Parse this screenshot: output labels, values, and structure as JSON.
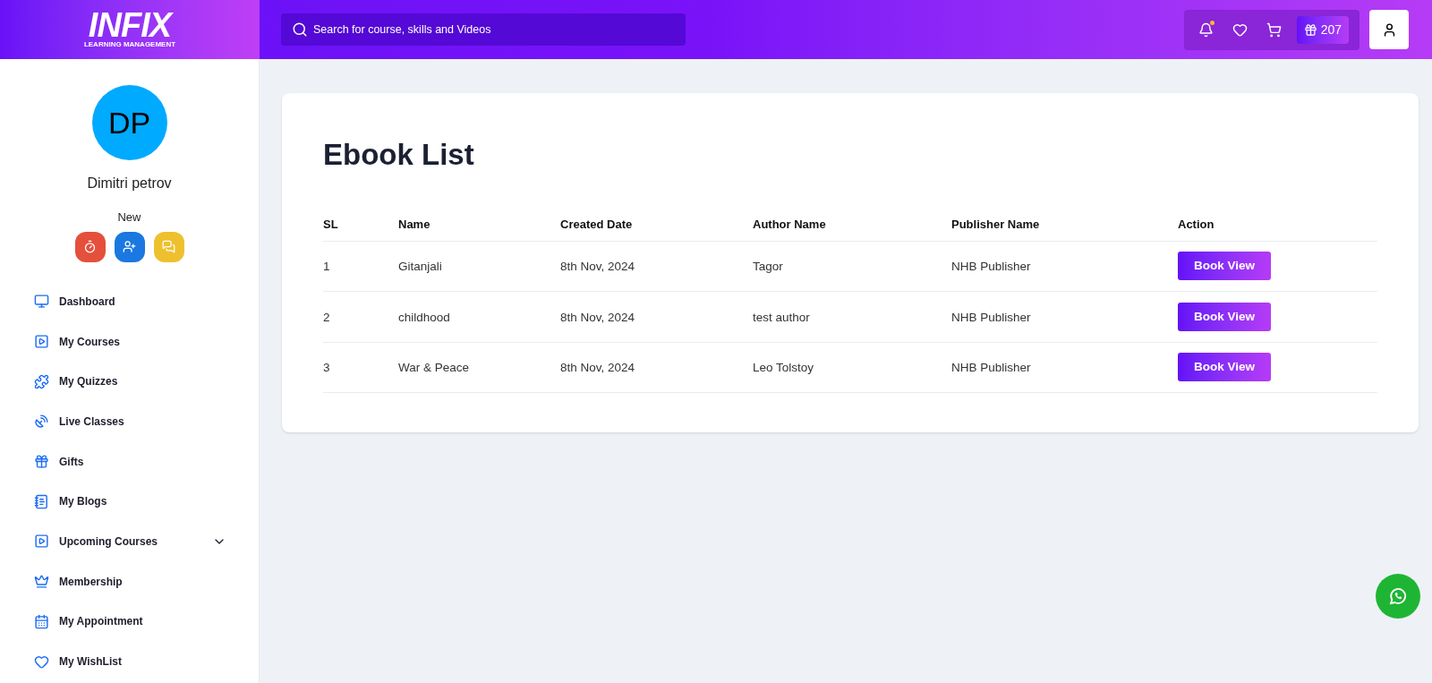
{
  "header": {
    "logo": {
      "wordmark": "INFIX",
      "tagline": "LEARNING MANAGEMENT"
    },
    "search": {
      "placeholder": "Search for course, skills and Videos"
    },
    "notifications": {
      "unread": true
    },
    "gift_points": "207"
  },
  "profile": {
    "initials": "DP",
    "name": "Dimitri petrov",
    "badge_level": "New"
  },
  "sidebar": {
    "items": [
      {
        "label": "Dashboard",
        "kind": "link"
      },
      {
        "label": "My Courses",
        "kind": "link"
      },
      {
        "label": "My Quizzes",
        "kind": "link"
      },
      {
        "label": "Live Classes",
        "kind": "link"
      },
      {
        "label": "Gifts",
        "kind": "link"
      },
      {
        "label": "My Blogs",
        "kind": "link"
      },
      {
        "label": "Upcoming Courses",
        "kind": "group",
        "expanded": false
      },
      {
        "label": "Membership",
        "kind": "link"
      },
      {
        "label": "My Appointment",
        "kind": "link"
      },
      {
        "label": "My WishList",
        "kind": "link"
      }
    ]
  },
  "page": {
    "title": "Ebook List",
    "table": {
      "columns": [
        "SL",
        "Name",
        "Created Date",
        "Author Name",
        "Publisher Name",
        "Action"
      ],
      "rows": [
        {
          "sl": "1",
          "name": "Gitanjali",
          "created": "8th Nov, 2024",
          "author": "Tagor",
          "publisher": "NHB Publisher",
          "action": "Book View"
        },
        {
          "sl": "2",
          "name": "childhood",
          "created": "8th Nov, 2024",
          "author": "test author",
          "publisher": "NHB Publisher",
          "action": "Book View"
        },
        {
          "sl": "3",
          "name": "War & Peace",
          "created": "8th Nov, 2024",
          "author": "Leo Tolstoy",
          "publisher": "NHB Publisher",
          "action": "Book View"
        }
      ]
    }
  }
}
